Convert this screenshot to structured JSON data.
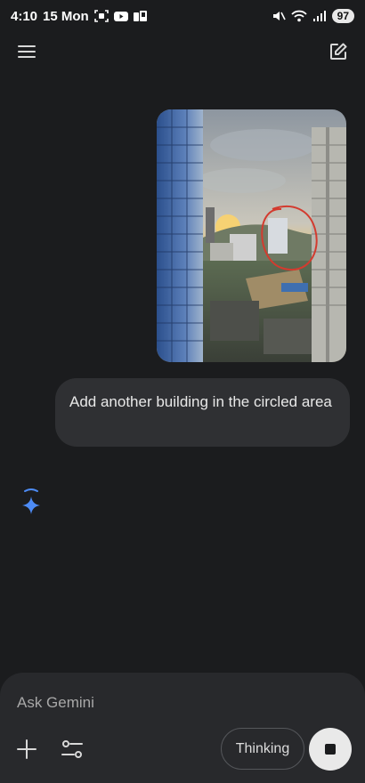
{
  "status_bar": {
    "time": "4:10",
    "date": "15 Mon",
    "battery": "97",
    "left_icons": [
      "screenshot-icon",
      "youtube-icon",
      "app-icon"
    ],
    "right_icons": [
      "mute-icon",
      "wifi-icon",
      "signal-icon"
    ]
  },
  "header": {
    "menu_icon": "menu-icon",
    "new_chat_icon": "edit-icon"
  },
  "conversation": {
    "user_image": "city skyline photo with red circle",
    "user_message": "Add another building in the circled area",
    "assistant_icon": "gemini-spark-icon"
  },
  "composer": {
    "placeholder": "Ask Gemini",
    "thinking_label": "Thinking",
    "plus_icon": "plus-icon",
    "tools_icon": "tools-icon",
    "stop_icon": "stop-icon"
  },
  "colors": {
    "background": "#1b1c1e",
    "bubble": "#2f3033",
    "composer": "#28292c",
    "gemini_blue": "#4d8bf5"
  }
}
